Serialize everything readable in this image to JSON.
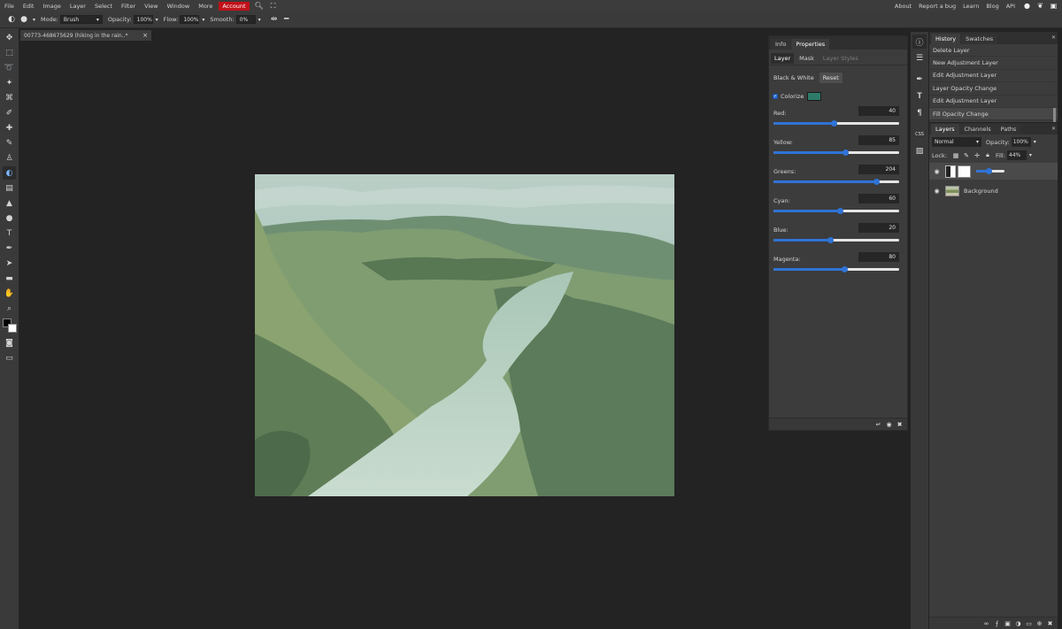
{
  "menu": {
    "items": [
      "File",
      "Edit",
      "Image",
      "Layer",
      "Select",
      "Filter",
      "View",
      "Window",
      "More"
    ],
    "account": "Account",
    "right_links": [
      "About",
      "Report a bug",
      "Learn",
      "Blog",
      "API"
    ]
  },
  "options": {
    "mode_label": "Mode:",
    "mode_value": "Brush",
    "opacity_label": "Opacity:",
    "opacity_value": "100%",
    "flow_label": "Flow:",
    "flow_value": "100%",
    "smooth_label": "Smooth:",
    "smooth_value": "0%"
  },
  "document": {
    "tab_title": "00773-468675629 (hiking in the rain..*",
    "close": "×"
  },
  "properties": {
    "tabs": [
      "Info",
      "Properties"
    ],
    "active_tab": 1,
    "subtabs": [
      "Layer",
      "Mask",
      "Layer Styles"
    ],
    "adjustment_name": "Black & White",
    "reset_label": "Reset",
    "colorize_label": "Colorize",
    "colorize_checked": true,
    "tint_color": "#2e7a68",
    "sliders": [
      {
        "name": "Red:",
        "value": "40",
        "fraction": 0.48
      },
      {
        "name": "Yellow:",
        "value": "85",
        "fraction": 0.57
      },
      {
        "name": "Greens:",
        "value": "204",
        "fraction": 0.82
      },
      {
        "name": "Cyan:",
        "value": "60",
        "fraction": 0.53
      },
      {
        "name": "Blue:",
        "value": "20",
        "fraction": 0.45
      },
      {
        "name": "Magenta:",
        "value": "80",
        "fraction": 0.56
      }
    ]
  },
  "history": {
    "tabs": [
      "History",
      "Swatches"
    ],
    "items": [
      "Delete Layer",
      "New Adjustment Layer",
      "Edit Adjustment Layer",
      "Layer Opacity Change",
      "Edit Adjustment Layer",
      "Fill Opacity Change"
    ],
    "selected_index": 5
  },
  "layers": {
    "tabs": [
      "Layers",
      "Channels",
      "Paths"
    ],
    "blend_mode": "Normal",
    "opacity_label": "Opacity:",
    "opacity_value": "100%",
    "lock_label": "Lock:",
    "fill_label": "Fill:",
    "fill_value": "44%",
    "adjustment_fraction": 0.44,
    "background_name": "Background"
  },
  "colors": {
    "accent": "#2f73d6",
    "account_red": "#c0121a",
    "foreground": "#000000",
    "background": "#ffffff"
  }
}
